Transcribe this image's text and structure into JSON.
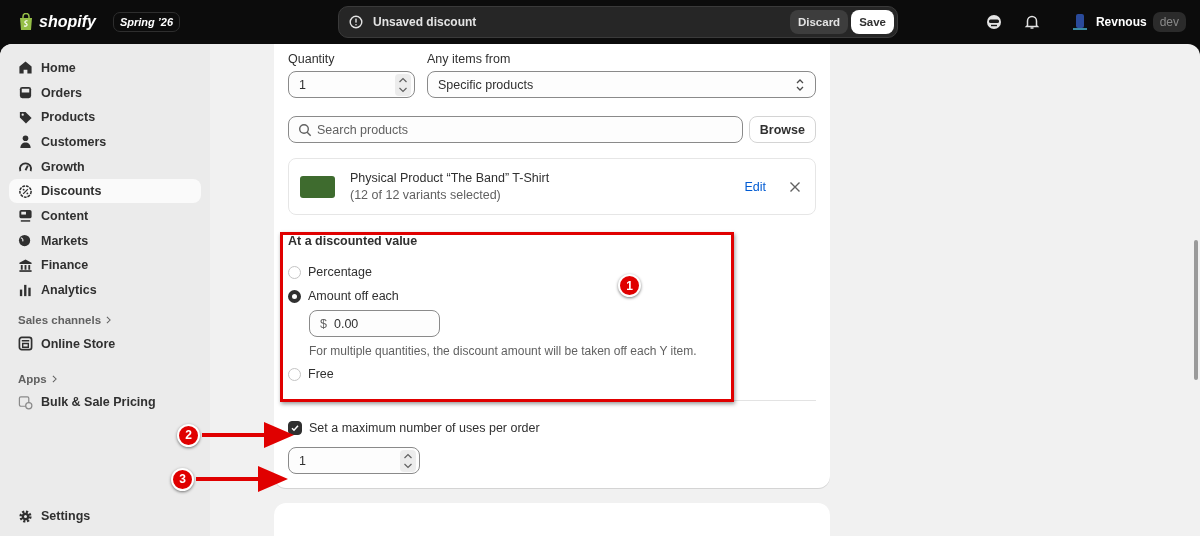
{
  "topbar": {
    "logo": "shopify",
    "release_badge": "Spring ’26",
    "save_bar": {
      "message": "Unsaved discount",
      "discard": "Discard",
      "save": "Save"
    },
    "store": {
      "name": "Revnous",
      "badge": "dev"
    }
  },
  "sidebar": {
    "items": [
      {
        "label": "Home",
        "selected": false
      },
      {
        "label": "Orders",
        "selected": false
      },
      {
        "label": "Products",
        "selected": false
      },
      {
        "label": "Customers",
        "selected": false
      },
      {
        "label": "Growth",
        "selected": false
      },
      {
        "label": "Discounts",
        "selected": true
      },
      {
        "label": "Content",
        "selected": false
      },
      {
        "label": "Markets",
        "selected": false
      },
      {
        "label": "Finance",
        "selected": false
      },
      {
        "label": "Analytics",
        "selected": false
      }
    ],
    "sales_channels": {
      "heading": "Sales channels",
      "items": [
        {
          "label": "Online Store"
        }
      ]
    },
    "apps": {
      "heading": "Apps",
      "items": [
        {
          "label": "Bulk & Sale Pricing"
        }
      ]
    },
    "settings": "Settings"
  },
  "form": {
    "quantity": {
      "label": "Quantity",
      "value": "1"
    },
    "any_items_from": {
      "label": "Any items from",
      "value": "Specific products"
    },
    "product_search": {
      "placeholder": "Search products",
      "browse": "Browse"
    },
    "product": {
      "name": "Physical Product “The Band” T-Shirt",
      "variants": "(12 of 12 variants selected)",
      "edit": "Edit"
    },
    "discounted_value": {
      "heading": "At a discounted value",
      "options": [
        {
          "label": "Percentage",
          "selected": false
        },
        {
          "label": "Amount off each",
          "selected": true
        },
        {
          "label": "Free",
          "selected": false
        }
      ],
      "amount_field": {
        "prefix": "$",
        "value": "0.00"
      },
      "help": "For multiple quantities, the discount amount will be taken off each Y item."
    },
    "max_uses": {
      "label": "Set a maximum number of uses per order",
      "checked": true,
      "value": "1"
    }
  },
  "annotations": [
    {
      "number": "1"
    },
    {
      "number": "2"
    },
    {
      "number": "3"
    }
  ]
}
